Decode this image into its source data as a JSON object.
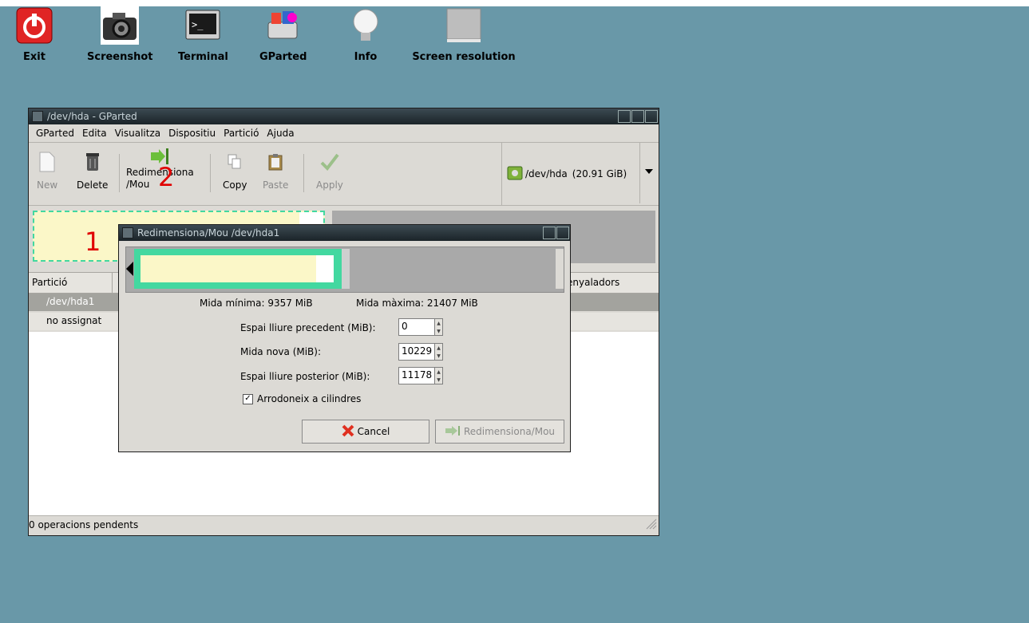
{
  "desktop": {
    "icons": [
      {
        "label": "Exit",
        "icon": "power-icon"
      },
      {
        "label": "Screenshot",
        "icon": "camera-icon"
      },
      {
        "label": "Terminal",
        "icon": "terminal-icon"
      },
      {
        "label": "GParted",
        "icon": "gparted-icon"
      },
      {
        "label": "Info",
        "icon": "lightbulb-icon"
      },
      {
        "label": "Screen resolution",
        "icon": "monitor-icon"
      }
    ]
  },
  "window": {
    "title": "/dev/hda - GParted",
    "menu": [
      "GParted",
      "Edita",
      "Visualitza",
      "Dispositiu",
      "Partició",
      "Ajuda"
    ],
    "toolbar": {
      "new": "New",
      "delete": "Delete",
      "resize_line1": "Redimensiona",
      "resize_line2": "/Mou",
      "copy": "Copy",
      "paste": "Paste",
      "apply": "Apply"
    },
    "device": {
      "name": "/dev/hda",
      "size": "(20.91 GiB)"
    },
    "list": {
      "col_partition": "Partició",
      "col_flags": "enyaladors",
      "rows": [
        {
          "partition": "/dev/hda1"
        },
        {
          "partition": "no assignat"
        }
      ]
    },
    "status": "0 operacions pendents"
  },
  "dialog": {
    "title": "Redimensiona/Mou /dev/hda1",
    "min_size": "Mida mínima: 9357 MiB",
    "max_size": "Mida màxima: 21407 MiB",
    "free_before_label": "Espai lliure precedent (MiB):",
    "free_before_value": "0",
    "new_size_label": "Mida nova (MiB):",
    "new_size_value": "10229",
    "free_after_label": "Espai lliure posterior (MiB):",
    "free_after_value": "11178",
    "round_label": "Arrodoneix a cilindres",
    "cancel_label": "Cancel",
    "resize_label": "Redimensiona/Mou"
  },
  "annotations": {
    "mark1": "1",
    "mark2": "2"
  }
}
